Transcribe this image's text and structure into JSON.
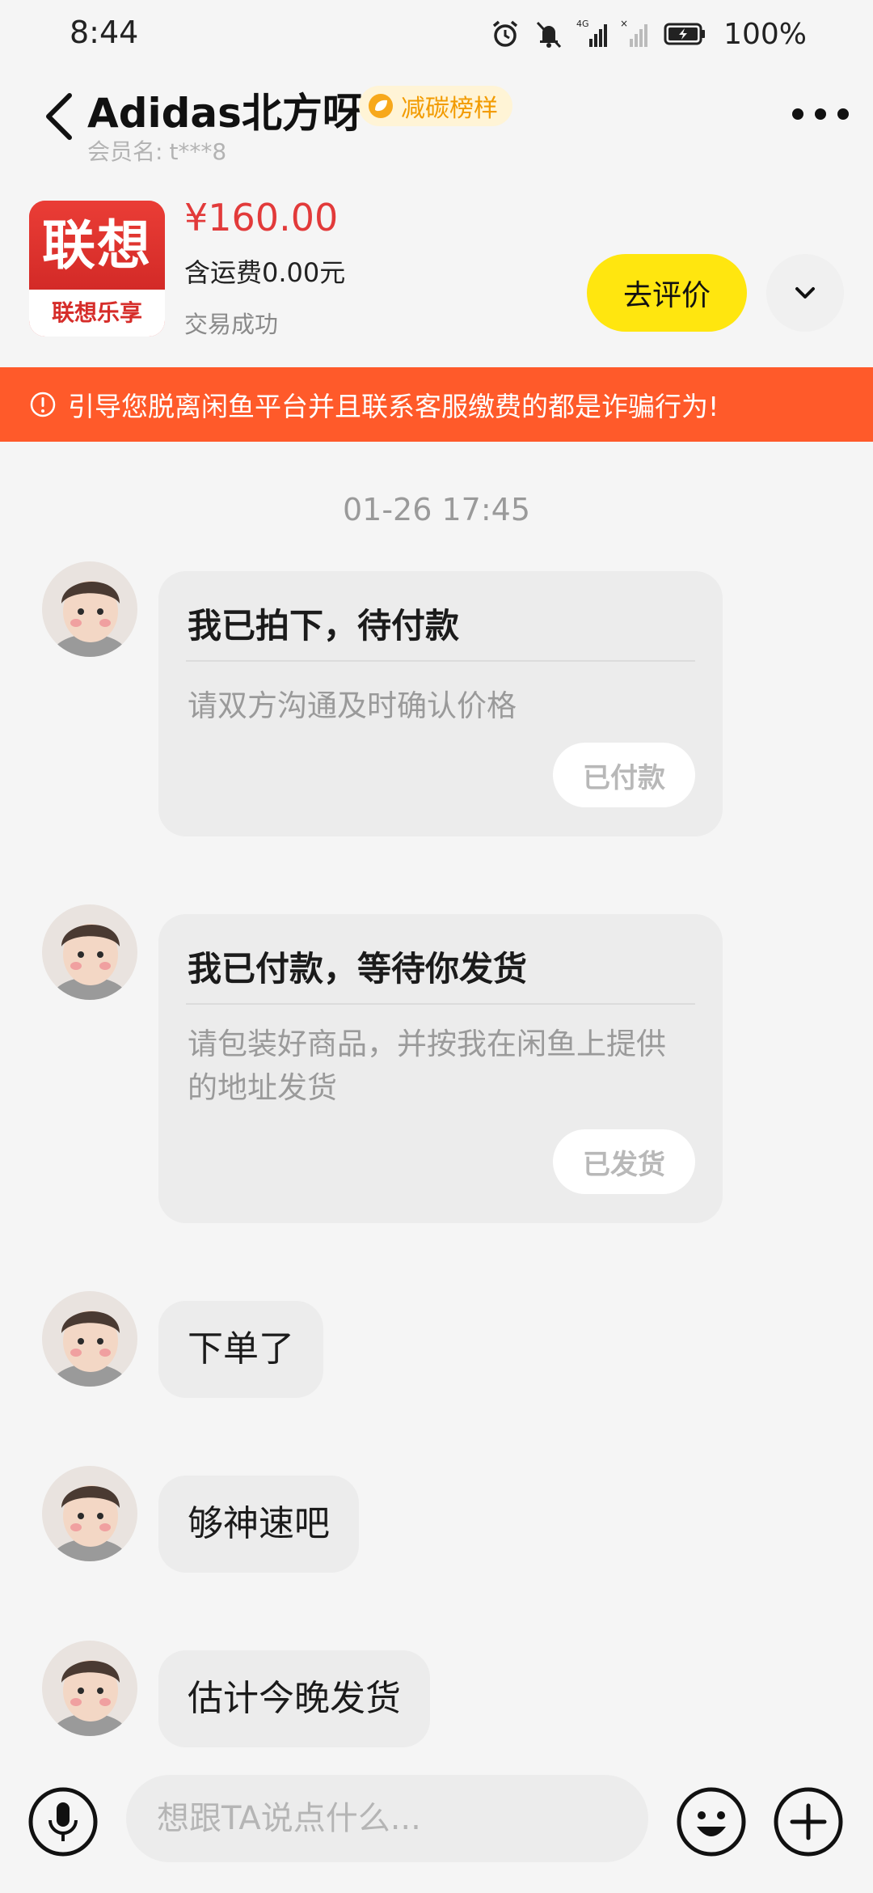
{
  "status_bar": {
    "time": "8:44",
    "network_label": "4G",
    "battery_percent": "100%",
    "icons": [
      "alarm-icon",
      "mute-bell-icon",
      "signal-4g-icon",
      "signal-no-sim-icon",
      "battery-charging-icon"
    ]
  },
  "header": {
    "seller_name": "Adidas北方呀",
    "badge": "减碳榜样",
    "member_label": "会员名:",
    "member_id": "t***8"
  },
  "product": {
    "thumb_top": "联想",
    "thumb_bottom": "联想乐享",
    "price": "¥160.00",
    "shipping": "含运费0.00元",
    "status": "交易成功",
    "review_button": "去评价"
  },
  "warning": {
    "text": "引导您脱离闲鱼平台并且联系客服缴费的都是诈骗行为!"
  },
  "chat": {
    "timestamp": "01-26 17:45",
    "cards": [
      {
        "title": "我已拍下，待付款",
        "desc": "请双方沟通及时确认价格",
        "button": "已付款"
      },
      {
        "title": "我已付款，等待你发货",
        "desc": "请包装好商品，并按我在闲鱼上提供的地址发货",
        "button": "已发货"
      }
    ],
    "messages": [
      "下单了",
      "够神速吧",
      "估计今晚发货"
    ]
  },
  "input": {
    "placeholder": "想跟TA说点什么..."
  },
  "colors": {
    "accent_yellow": "#ffe60f",
    "warning_orange": "#ff5a2a",
    "price_red": "#e23a3a",
    "badge_orange": "#f29b00"
  }
}
